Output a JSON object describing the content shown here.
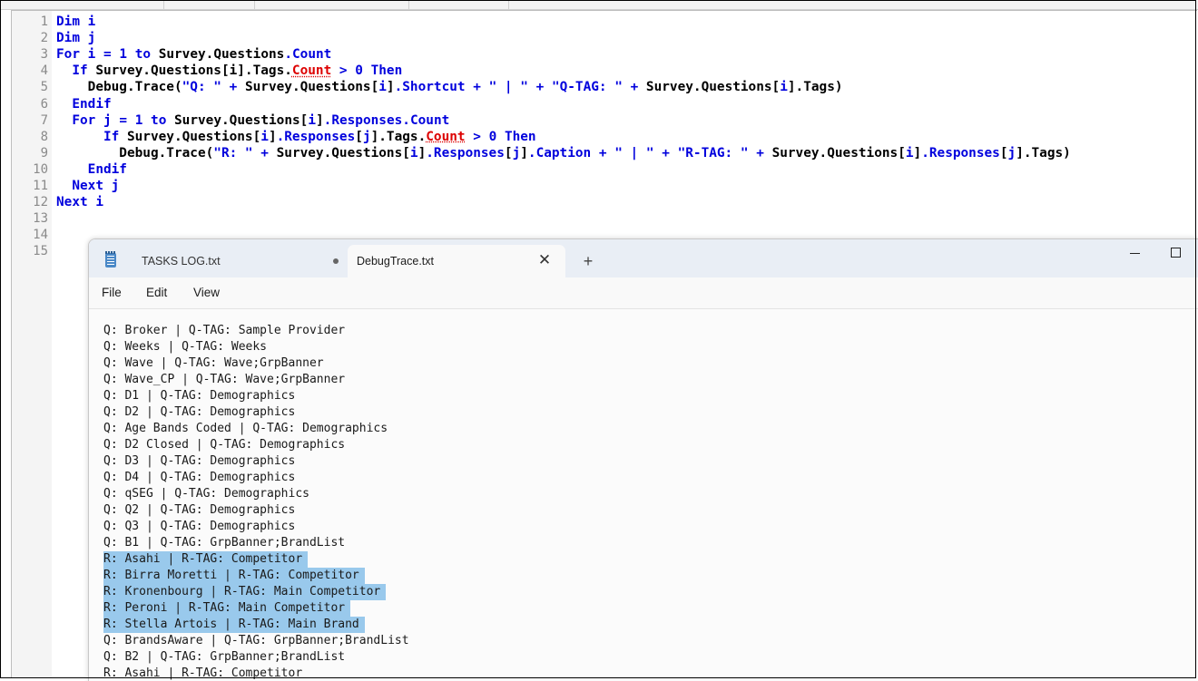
{
  "editor": {
    "line_numbers": [
      "1",
      "2",
      "3",
      "4",
      "5",
      "6",
      "7",
      "8",
      "9",
      "10",
      "11",
      "12",
      "13",
      "14",
      "15"
    ],
    "lines": [
      [
        {
          "t": "kw",
          "v": "Dim"
        },
        {
          "t": "plain",
          "v": " "
        },
        {
          "t": "kw",
          "v": "i"
        }
      ],
      [
        {
          "t": "kw",
          "v": "Dim"
        },
        {
          "t": "plain",
          "v": " "
        },
        {
          "t": "kw",
          "v": "j"
        }
      ],
      [
        {
          "t": "kw",
          "v": "For"
        },
        {
          "t": "plain",
          "v": " "
        },
        {
          "t": "kw",
          "v": "i"
        },
        {
          "t": "plain",
          "v": " "
        },
        {
          "t": "kw",
          "v": "="
        },
        {
          "t": "plain",
          "v": " "
        },
        {
          "t": "num",
          "v": "1"
        },
        {
          "t": "plain",
          "v": " "
        },
        {
          "t": "kw",
          "v": "to"
        },
        {
          "t": "plain",
          "v": " Survey.Questions"
        },
        {
          "t": "prop",
          "v": ".Count"
        }
      ],
      [
        {
          "t": "plain",
          "v": "  "
        },
        {
          "t": "kw",
          "v": "If"
        },
        {
          "t": "plain",
          "v": " Survey.Questions[i].Tags."
        },
        {
          "t": "err",
          "v": "Count"
        },
        {
          "t": "plain",
          "v": " "
        },
        {
          "t": "kw",
          "v": ">"
        },
        {
          "t": "plain",
          "v": " "
        },
        {
          "t": "num",
          "v": "0"
        },
        {
          "t": "plain",
          "v": " "
        },
        {
          "t": "kw",
          "v": "Then"
        }
      ],
      [
        {
          "t": "plain",
          "v": "    Debug.Trace("
        },
        {
          "t": "str",
          "v": "\"Q: \""
        },
        {
          "t": "plain",
          "v": " "
        },
        {
          "t": "kw",
          "v": "+"
        },
        {
          "t": "plain",
          "v": " Survey.Questions["
        },
        {
          "t": "kw",
          "v": "i"
        },
        {
          "t": "plain",
          "v": "]"
        },
        {
          "t": "prop",
          "v": ".Shortcut"
        },
        {
          "t": "plain",
          "v": " "
        },
        {
          "t": "kw",
          "v": "+"
        },
        {
          "t": "plain",
          "v": " "
        },
        {
          "t": "str",
          "v": "\" | \""
        },
        {
          "t": "plain",
          "v": " "
        },
        {
          "t": "kw",
          "v": "+"
        },
        {
          "t": "plain",
          "v": " "
        },
        {
          "t": "str",
          "v": "\"Q-TAG: \""
        },
        {
          "t": "plain",
          "v": " "
        },
        {
          "t": "kw",
          "v": "+"
        },
        {
          "t": "plain",
          "v": " Survey.Questions["
        },
        {
          "t": "kw",
          "v": "i"
        },
        {
          "t": "plain",
          "v": "].Tags)"
        }
      ],
      [
        {
          "t": "plain",
          "v": "  "
        },
        {
          "t": "kw",
          "v": "Endif"
        }
      ],
      [
        {
          "t": "plain",
          "v": "  "
        },
        {
          "t": "kw",
          "v": "For"
        },
        {
          "t": "plain",
          "v": " "
        },
        {
          "t": "kw",
          "v": "j"
        },
        {
          "t": "plain",
          "v": " "
        },
        {
          "t": "kw",
          "v": "="
        },
        {
          "t": "plain",
          "v": " "
        },
        {
          "t": "num",
          "v": "1"
        },
        {
          "t": "plain",
          "v": " "
        },
        {
          "t": "kw",
          "v": "to"
        },
        {
          "t": "plain",
          "v": " Survey.Questions["
        },
        {
          "t": "kw",
          "v": "i"
        },
        {
          "t": "plain",
          "v": "]"
        },
        {
          "t": "prop",
          "v": ".Responses.Count"
        }
      ],
      [
        {
          "t": "plain",
          "v": "      "
        },
        {
          "t": "kw",
          "v": "If"
        },
        {
          "t": "plain",
          "v": " Survey.Questions["
        },
        {
          "t": "kw",
          "v": "i"
        },
        {
          "t": "plain",
          "v": "]"
        },
        {
          "t": "prop",
          "v": ".Responses"
        },
        {
          "t": "plain",
          "v": "["
        },
        {
          "t": "kw",
          "v": "j"
        },
        {
          "t": "plain",
          "v": "].Tags."
        },
        {
          "t": "err",
          "v": "Count"
        },
        {
          "t": "plain",
          "v": " "
        },
        {
          "t": "kw",
          "v": ">"
        },
        {
          "t": "plain",
          "v": " "
        },
        {
          "t": "num",
          "v": "0"
        },
        {
          "t": "plain",
          "v": " "
        },
        {
          "t": "kw",
          "v": "Then"
        }
      ],
      [
        {
          "t": "plain",
          "v": "        Debug.Trace("
        },
        {
          "t": "str",
          "v": "\"R: \""
        },
        {
          "t": "plain",
          "v": " "
        },
        {
          "t": "kw",
          "v": "+"
        },
        {
          "t": "plain",
          "v": " Survey.Questions["
        },
        {
          "t": "kw",
          "v": "i"
        },
        {
          "t": "plain",
          "v": "]"
        },
        {
          "t": "prop",
          "v": ".Responses"
        },
        {
          "t": "plain",
          "v": "["
        },
        {
          "t": "kw",
          "v": "j"
        },
        {
          "t": "plain",
          "v": "]"
        },
        {
          "t": "prop",
          "v": ".Caption"
        },
        {
          "t": "plain",
          "v": " "
        },
        {
          "t": "kw",
          "v": "+"
        },
        {
          "t": "plain",
          "v": " "
        },
        {
          "t": "str",
          "v": "\" | \""
        },
        {
          "t": "plain",
          "v": " "
        },
        {
          "t": "kw",
          "v": "+"
        },
        {
          "t": "plain",
          "v": " "
        },
        {
          "t": "str",
          "v": "\"R-TAG: \""
        },
        {
          "t": "plain",
          "v": " "
        },
        {
          "t": "kw",
          "v": "+"
        },
        {
          "t": "plain",
          "v": " Survey.Questions["
        },
        {
          "t": "kw",
          "v": "i"
        },
        {
          "t": "plain",
          "v": "]"
        },
        {
          "t": "prop",
          "v": ".Responses"
        },
        {
          "t": "plain",
          "v": "["
        },
        {
          "t": "kw",
          "v": "j"
        },
        {
          "t": "plain",
          "v": "].Tags)"
        }
      ],
      [
        {
          "t": "plain",
          "v": "    "
        },
        {
          "t": "kw",
          "v": "Endif"
        }
      ],
      [
        {
          "t": "plain",
          "v": "  "
        },
        {
          "t": "kw",
          "v": "Next"
        },
        {
          "t": "plain",
          "v": " "
        },
        {
          "t": "kw",
          "v": "j"
        }
      ],
      [
        {
          "t": "kw",
          "v": "Next"
        },
        {
          "t": "plain",
          "v": " "
        },
        {
          "t": "kw",
          "v": "i"
        }
      ],
      [],
      [],
      []
    ]
  },
  "notepad": {
    "tabs": [
      {
        "label": "TASKS LOG.txt",
        "active": false,
        "unsaved": true
      },
      {
        "label": "DebugTrace.txt",
        "active": true
      }
    ],
    "menu": [
      "File",
      "Edit",
      "View"
    ],
    "lines": [
      {
        "text": "Q: Broker | Q-TAG: Sample Provider",
        "selected": false
      },
      {
        "text": "Q: Weeks | Q-TAG: Weeks",
        "selected": false
      },
      {
        "text": "Q: Wave | Q-TAG: Wave;GrpBanner",
        "selected": false
      },
      {
        "text": "Q: Wave_CP | Q-TAG: Wave;GrpBanner",
        "selected": false
      },
      {
        "text": "Q: D1 | Q-TAG: Demographics",
        "selected": false
      },
      {
        "text": "Q: D2 | Q-TAG: Demographics",
        "selected": false
      },
      {
        "text": "Q: Age Bands Coded | Q-TAG: Demographics",
        "selected": false
      },
      {
        "text": "Q: D2 Closed | Q-TAG: Demographics",
        "selected": false
      },
      {
        "text": "Q: D3 | Q-TAG: Demographics",
        "selected": false
      },
      {
        "text": "Q: D4 | Q-TAG: Demographics",
        "selected": false
      },
      {
        "text": "Q: qSEG | Q-TAG: Demographics",
        "selected": false
      },
      {
        "text": "Q: Q2 | Q-TAG: Demographics",
        "selected": false
      },
      {
        "text": "Q: Q3 | Q-TAG: Demographics",
        "selected": false
      },
      {
        "text": "Q: B1 | Q-TAG: GrpBanner;BrandList",
        "selected": false
      },
      {
        "text": "R: Asahi | R-TAG: Competitor",
        "selected": true
      },
      {
        "text": "R: Birra Moretti | R-TAG: Competitor",
        "selected": true
      },
      {
        "text": "R: Kronenbourg | R-TAG: Main Competitor",
        "selected": true
      },
      {
        "text": "R: Peroni | R-TAG: Main Competitor",
        "selected": true
      },
      {
        "text": "R: Stella Artois | R-TAG: Main Brand",
        "selected": true
      },
      {
        "text": "Q: BrandsAware | Q-TAG: GrpBanner;BrandList",
        "selected": false
      },
      {
        "text": "Q: B2 | Q-TAG: GrpBanner;BrandList",
        "selected": false
      },
      {
        "text": "R: Asahi | R-TAG: Competitor",
        "selected": false
      }
    ]
  }
}
